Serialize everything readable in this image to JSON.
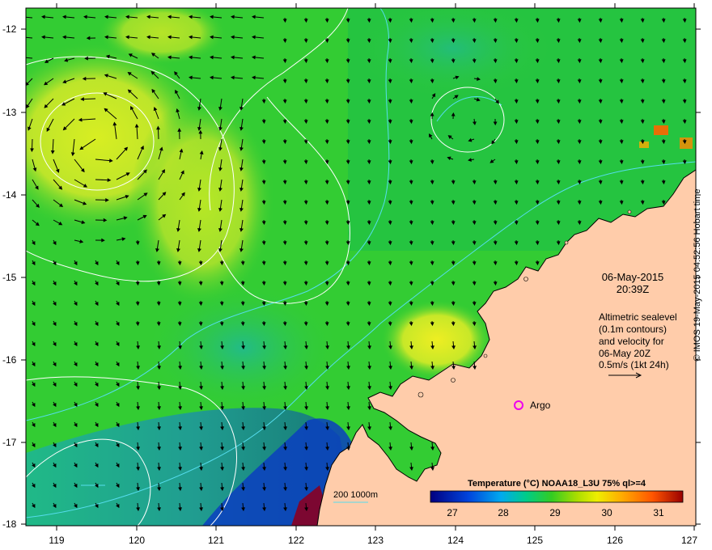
{
  "map": {
    "date": "06-May-2015",
    "time": "20:39Z",
    "altimetry_lines": [
      "Altimetric sealevel",
      "(0.1m contours)",
      "and velocity for",
      "06-May 20Z"
    ],
    "speed_scale": "0.5m/s (1kt 24h)",
    "argo_label": "Argo",
    "bathy_label": "200  1000m",
    "colorbar": {
      "title": "Temperature (°C) NOAA18_L3U 75% ql>=4",
      "ticks": [
        "27",
        "28",
        "29",
        "30",
        "31"
      ]
    },
    "credit": "© IMOS 19-May-2015 04:52:56 Hobart time",
    "x_axis_ticks": [
      "119",
      "120",
      "121",
      "122",
      "123",
      "124",
      "125",
      "126",
      "127"
    ],
    "y_axis_ticks": [
      "-12",
      "-13",
      "-14",
      "-15",
      "-16",
      "-17",
      "-18"
    ],
    "colors": {
      "ocean_green": "#33cc33",
      "warm_yellow": "#ccee22",
      "cool_blue": "#1166cc",
      "land": "#ffccaa",
      "contour": "#ffffff",
      "bathymetry": "#55ddee",
      "argo_marker": "#ee00ee"
    }
  }
}
